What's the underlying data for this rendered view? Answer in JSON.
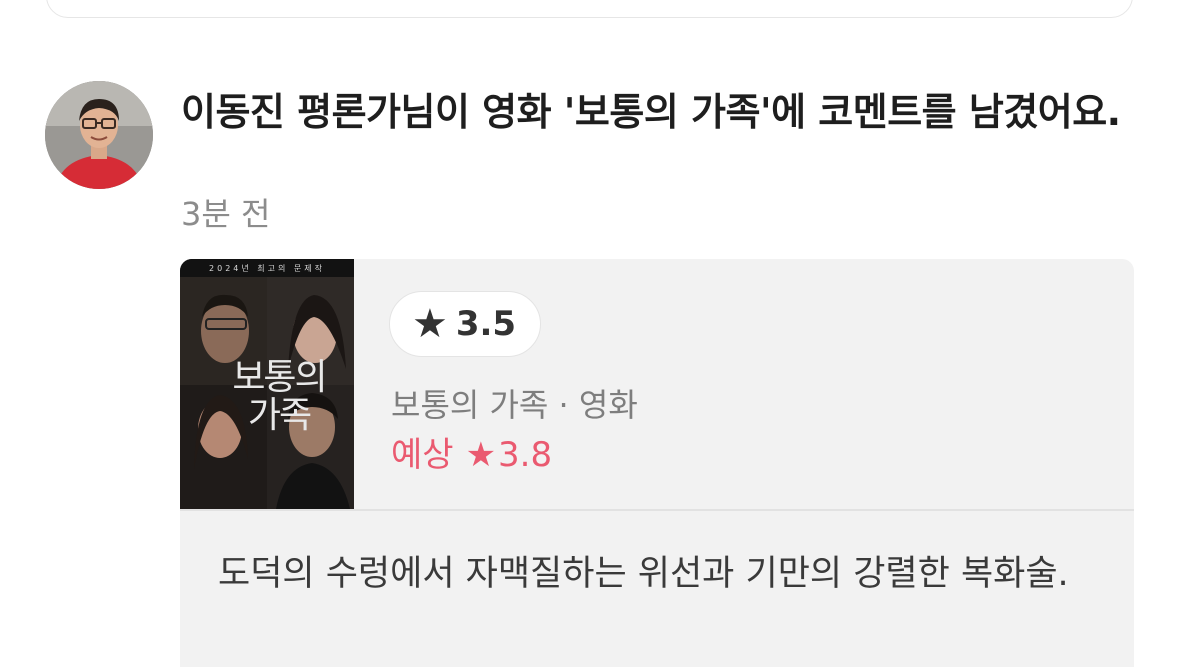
{
  "feed_item": {
    "headline": "이동진 평론가님이 영화 '보통의 가족'에 코멘트를 남겼어요.",
    "time_ago": "3분 전",
    "avatar_icon": "user-avatar"
  },
  "movie_card": {
    "poster_title": "보통의 가족",
    "poster_tagline": "2024년 최고의 문제작",
    "my_rating": {
      "star_icon": "star",
      "value": "3.5"
    },
    "meta": "보통의 가족 · 영화",
    "expected": {
      "label": "예상",
      "star_icon": "star",
      "value": "3.8",
      "color": "#ea5a70"
    },
    "comment": "도덕의 수렁에서 자맥질하는 위선과 기만의 강렬한 복화술."
  }
}
